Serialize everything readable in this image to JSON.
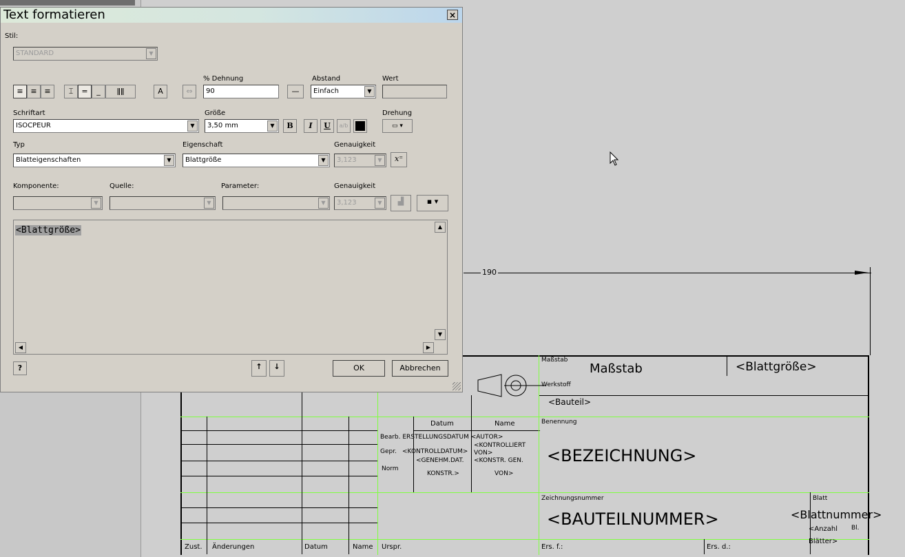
{
  "dialog": {
    "title": "Text formatieren",
    "close": "×",
    "stil_label": "Stil:",
    "stil_value": "STANDARD",
    "dehnung_label": "% Dehnung",
    "dehnung_value": "90",
    "abstand_label": "Abstand",
    "abstand_value": "Einfach",
    "wert_label": "Wert",
    "schriftart_label": "Schriftart",
    "schriftart_value": "ISOCPEUR",
    "groesse_label": "Größe",
    "groesse_value": "3,50 mm",
    "drehung_label": "Drehung",
    "typ_label": "Typ",
    "typ_value": "Blatteigenschaften",
    "eigenschaft_label": "Eigenschaft",
    "eigenschaft_value": "Blattgröße",
    "genauigkeit_label": "Genauigkeit",
    "genauigkeit_value": "3,123",
    "komponente_label": "Komponente:",
    "quelle_label": "Quelle:",
    "parameter_label": "Parameter:",
    "genauigkeit2_label": "Genauigkeit",
    "genauigkeit2_value": "3,123",
    "editor_text": "<Blattgröße>",
    "ok": "OK",
    "abbrechen": "Abbrechen",
    "bold": "B",
    "italic": "I",
    "underline": "U",
    "text_color": "#000000"
  },
  "drawing": {
    "dimension_value": "190",
    "title_block": {
      "massstab_label": "Maßstab",
      "massstab_value": "Maßstab",
      "blattgroesse": "<Blattgröße>",
      "werkstoff_label": "Werkstoff",
      "bauteil": "<Bauteil>",
      "datum": "Datum",
      "name": "Name",
      "benennung_label": "Benennung",
      "bearb_row": "Bearb. ERSTELLUNGSDATUM <AUTOR>",
      "gepr_label": "Gepr.",
      "gepr_date": "<KONTROLLDATUM>",
      "gepr_name": "<KONTROLLIERT VON>",
      "genehm_date": "<GENEHM.DAT.",
      "genehm_name": "<KONSTR. GEN.",
      "norm_label": "Norm",
      "konstr": "KONSTR.>",
      "von": "VON>",
      "bezeichnung": "<BEZEICHNUNG>",
      "zeichnungsnummer_label": "Zeichnungsnummer",
      "bauteilnummer": "<BAUTEILNUMMER>",
      "blatt_label": "Blatt",
      "blattnummer": "<Blattnummer>",
      "anzahl_blaetter": "<Anzahl Blätter>",
      "bl_label": "Bl.",
      "zust": "Zust.",
      "aenderungen": "Änderungen",
      "datum2": "Datum",
      "name2": "Name",
      "urspr": "Urspr.",
      "ers_f": "Ers. f.:",
      "ers_d": "Ers. d.:"
    }
  },
  "colors": {
    "grid_green": "#7fff3f",
    "dialog_bg": "#d4d0c8"
  }
}
